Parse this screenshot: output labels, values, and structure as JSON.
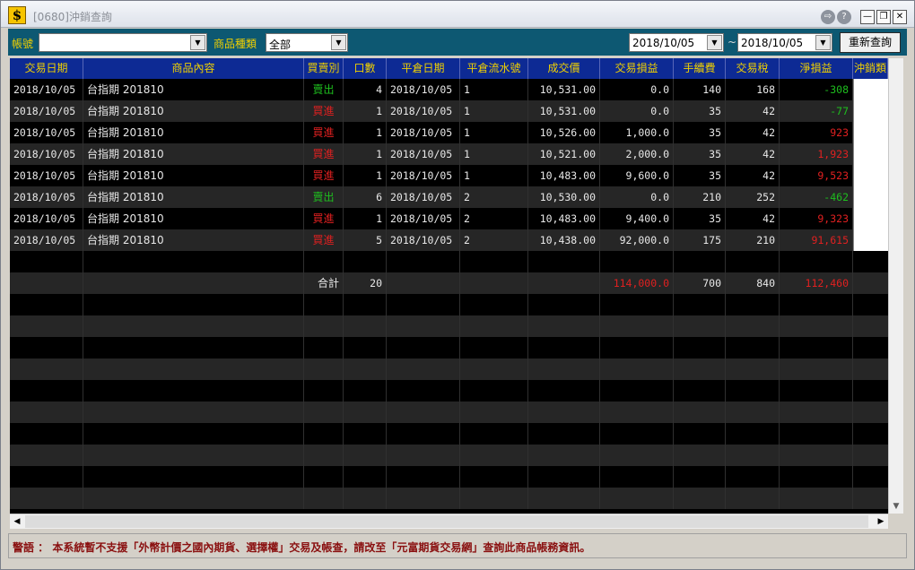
{
  "window": {
    "icon_glyph": "$",
    "title": "[0680]沖銷查詢",
    "title_buttons": [
      "⇨",
      "?"
    ],
    "controls": {
      "minimize": "—",
      "restore": "❐",
      "close": "✕"
    }
  },
  "toolbar": {
    "account_label": "帳號",
    "account_value": "",
    "product_type_label": "商品種類",
    "product_type_value": "全部",
    "date_from": "2018/10/05",
    "date_separator": "~",
    "date_to": "2018/10/05",
    "requery_button": "重新查詢",
    "dropdown_glyph": "▼"
  },
  "table": {
    "columns": [
      "交易日期",
      "商品內容",
      "買賣別",
      "口數",
      "平倉日期",
      "平倉流水號",
      "成交價",
      "交易損益",
      "手續費",
      "交易稅",
      "淨損益",
      "沖銷類"
    ],
    "rows": [
      [
        "2018/10/05",
        "台指期 201810",
        "賣出",
        "4",
        "2018/10/05",
        "1",
        "10,531.00",
        "0.0",
        "140",
        "168",
        "-308"
      ],
      [
        "2018/10/05",
        "台指期 201810",
        "買進",
        "1",
        "2018/10/05",
        "1",
        "10,531.00",
        "0.0",
        "35",
        "42",
        "-77"
      ],
      [
        "2018/10/05",
        "台指期 201810",
        "買進",
        "1",
        "2018/10/05",
        "1",
        "10,526.00",
        "1,000.0",
        "35",
        "42",
        "923"
      ],
      [
        "2018/10/05",
        "台指期 201810",
        "買進",
        "1",
        "2018/10/05",
        "1",
        "10,521.00",
        "2,000.0",
        "35",
        "42",
        "1,923"
      ],
      [
        "2018/10/05",
        "台指期 201810",
        "買進",
        "1",
        "2018/10/05",
        "1",
        "10,483.00",
        "9,600.0",
        "35",
        "42",
        "9,523"
      ],
      [
        "2018/10/05",
        "台指期 201810",
        "賣出",
        "6",
        "2018/10/05",
        "2",
        "10,530.00",
        "0.0",
        "210",
        "252",
        "-462"
      ],
      [
        "2018/10/05",
        "台指期 201810",
        "買進",
        "1",
        "2018/10/05",
        "2",
        "10,483.00",
        "9,400.0",
        "35",
        "42",
        "9,323"
      ],
      [
        "2018/10/05",
        "台指期 201810",
        "買進",
        "5",
        "2018/10/05",
        "2",
        "10,438.00",
        "92,000.0",
        "175",
        "210",
        "91,615"
      ]
    ],
    "total": {
      "label": "合計",
      "lots": "20",
      "trade_pnl": "114,000.0",
      "fee": "700",
      "tax": "840",
      "net_pnl": "112,460"
    },
    "colors": {
      "sell": "#1ebe1e",
      "buy": "#e02020",
      "negative": "#1ebe1e",
      "positive": "#e02020",
      "header_bg": "#0d2a94",
      "header_text": "#f0d000"
    }
  },
  "footer": {
    "message": "警語 ： 本系統暫不支援「外幣計價之國內期貨、選擇權」交易及帳查，請改至「元富期貨交易網」查詢此商品帳務資訊。"
  },
  "scroll": {
    "up": "▲",
    "down": "▼",
    "left": "◀",
    "right": "▶"
  }
}
